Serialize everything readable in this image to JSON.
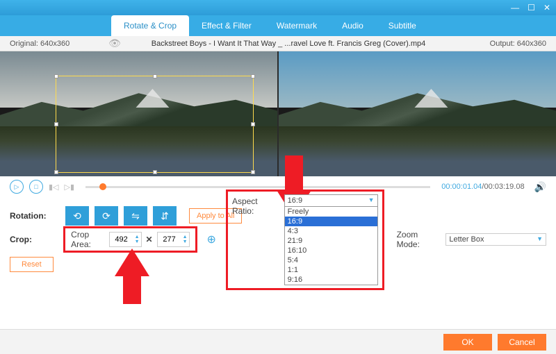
{
  "window": {
    "minimize": "—",
    "maximize": "☐",
    "close": "✕"
  },
  "tabs": [
    "Rotate & Crop",
    "Effect & Filter",
    "Watermark",
    "Audio",
    "Subtitle"
  ],
  "active_tab": 0,
  "infobar": {
    "original": "Original: 640x360",
    "title": "Backstreet Boys - I Want It That Way _ ...ravel Love ft. Francis Greg (Cover).mp4",
    "output": "Output: 640x360"
  },
  "transport": {
    "current": "00:00:01.04",
    "duration": "/00:03:19.08"
  },
  "rotation": {
    "label": "Rotation:",
    "apply": "Apply to All"
  },
  "crop": {
    "label": "Crop:",
    "area_label": "Crop Area:",
    "width": "492",
    "height": "277",
    "reset": "Reset"
  },
  "aspect": {
    "label": "Aspect Ratio:",
    "selected": "16:9",
    "options": [
      "Freely",
      "16:9",
      "4:3",
      "21:9",
      "16:10",
      "5:4",
      "1:1",
      "9:16"
    ]
  },
  "zoom": {
    "label": "Zoom Mode:",
    "value": "Letter Box"
  },
  "footer": {
    "ok": "OK",
    "cancel": "Cancel"
  }
}
